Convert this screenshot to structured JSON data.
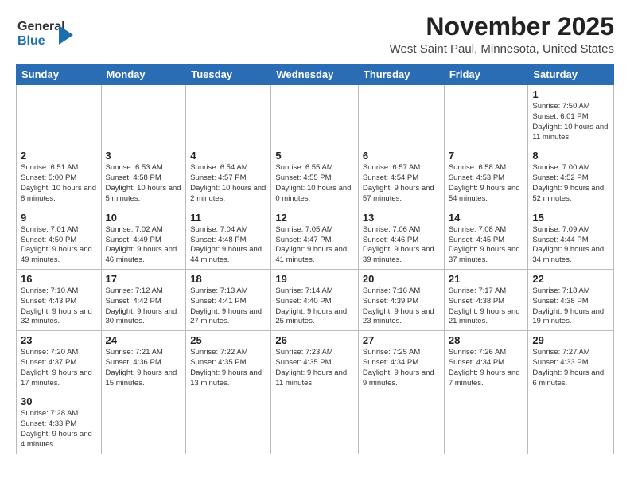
{
  "header": {
    "logo_general": "General",
    "logo_blue": "Blue",
    "month_title": "November 2025",
    "location": "West Saint Paul, Minnesota, United States"
  },
  "days_of_week": [
    "Sunday",
    "Monday",
    "Tuesday",
    "Wednesday",
    "Thursday",
    "Friday",
    "Saturday"
  ],
  "weeks": [
    [
      {
        "day": "",
        "info": ""
      },
      {
        "day": "",
        "info": ""
      },
      {
        "day": "",
        "info": ""
      },
      {
        "day": "",
        "info": ""
      },
      {
        "day": "",
        "info": ""
      },
      {
        "day": "",
        "info": ""
      },
      {
        "day": "1",
        "info": "Sunrise: 7:50 AM\nSunset: 6:01 PM\nDaylight: 10 hours and 11 minutes."
      }
    ],
    [
      {
        "day": "2",
        "info": "Sunrise: 6:51 AM\nSunset: 5:00 PM\nDaylight: 10 hours and 8 minutes."
      },
      {
        "day": "3",
        "info": "Sunrise: 6:53 AM\nSunset: 4:58 PM\nDaylight: 10 hours and 5 minutes."
      },
      {
        "day": "4",
        "info": "Sunrise: 6:54 AM\nSunset: 4:57 PM\nDaylight: 10 hours and 2 minutes."
      },
      {
        "day": "5",
        "info": "Sunrise: 6:55 AM\nSunset: 4:55 PM\nDaylight: 10 hours and 0 minutes."
      },
      {
        "day": "6",
        "info": "Sunrise: 6:57 AM\nSunset: 4:54 PM\nDaylight: 9 hours and 57 minutes."
      },
      {
        "day": "7",
        "info": "Sunrise: 6:58 AM\nSunset: 4:53 PM\nDaylight: 9 hours and 54 minutes."
      },
      {
        "day": "8",
        "info": "Sunrise: 7:00 AM\nSunset: 4:52 PM\nDaylight: 9 hours and 52 minutes."
      }
    ],
    [
      {
        "day": "9",
        "info": "Sunrise: 7:01 AM\nSunset: 4:50 PM\nDaylight: 9 hours and 49 minutes."
      },
      {
        "day": "10",
        "info": "Sunrise: 7:02 AM\nSunset: 4:49 PM\nDaylight: 9 hours and 46 minutes."
      },
      {
        "day": "11",
        "info": "Sunrise: 7:04 AM\nSunset: 4:48 PM\nDaylight: 9 hours and 44 minutes."
      },
      {
        "day": "12",
        "info": "Sunrise: 7:05 AM\nSunset: 4:47 PM\nDaylight: 9 hours and 41 minutes."
      },
      {
        "day": "13",
        "info": "Sunrise: 7:06 AM\nSunset: 4:46 PM\nDaylight: 9 hours and 39 minutes."
      },
      {
        "day": "14",
        "info": "Sunrise: 7:08 AM\nSunset: 4:45 PM\nDaylight: 9 hours and 37 minutes."
      },
      {
        "day": "15",
        "info": "Sunrise: 7:09 AM\nSunset: 4:44 PM\nDaylight: 9 hours and 34 minutes."
      }
    ],
    [
      {
        "day": "16",
        "info": "Sunrise: 7:10 AM\nSunset: 4:43 PM\nDaylight: 9 hours and 32 minutes."
      },
      {
        "day": "17",
        "info": "Sunrise: 7:12 AM\nSunset: 4:42 PM\nDaylight: 9 hours and 30 minutes."
      },
      {
        "day": "18",
        "info": "Sunrise: 7:13 AM\nSunset: 4:41 PM\nDaylight: 9 hours and 27 minutes."
      },
      {
        "day": "19",
        "info": "Sunrise: 7:14 AM\nSunset: 4:40 PM\nDaylight: 9 hours and 25 minutes."
      },
      {
        "day": "20",
        "info": "Sunrise: 7:16 AM\nSunset: 4:39 PM\nDaylight: 9 hours and 23 minutes."
      },
      {
        "day": "21",
        "info": "Sunrise: 7:17 AM\nSunset: 4:38 PM\nDaylight: 9 hours and 21 minutes."
      },
      {
        "day": "22",
        "info": "Sunrise: 7:18 AM\nSunset: 4:38 PM\nDaylight: 9 hours and 19 minutes."
      }
    ],
    [
      {
        "day": "23",
        "info": "Sunrise: 7:20 AM\nSunset: 4:37 PM\nDaylight: 9 hours and 17 minutes."
      },
      {
        "day": "24",
        "info": "Sunrise: 7:21 AM\nSunset: 4:36 PM\nDaylight: 9 hours and 15 minutes."
      },
      {
        "day": "25",
        "info": "Sunrise: 7:22 AM\nSunset: 4:35 PM\nDaylight: 9 hours and 13 minutes."
      },
      {
        "day": "26",
        "info": "Sunrise: 7:23 AM\nSunset: 4:35 PM\nDaylight: 9 hours and 11 minutes."
      },
      {
        "day": "27",
        "info": "Sunrise: 7:25 AM\nSunset: 4:34 PM\nDaylight: 9 hours and 9 minutes."
      },
      {
        "day": "28",
        "info": "Sunrise: 7:26 AM\nSunset: 4:34 PM\nDaylight: 9 hours and 7 minutes."
      },
      {
        "day": "29",
        "info": "Sunrise: 7:27 AM\nSunset: 4:33 PM\nDaylight: 9 hours and 6 minutes."
      }
    ],
    [
      {
        "day": "30",
        "info": "Sunrise: 7:28 AM\nSunset: 4:33 PM\nDaylight: 9 hours and 4 minutes."
      },
      {
        "day": "",
        "info": ""
      },
      {
        "day": "",
        "info": ""
      },
      {
        "day": "",
        "info": ""
      },
      {
        "day": "",
        "info": ""
      },
      {
        "day": "",
        "info": ""
      },
      {
        "day": "",
        "info": ""
      }
    ]
  ]
}
